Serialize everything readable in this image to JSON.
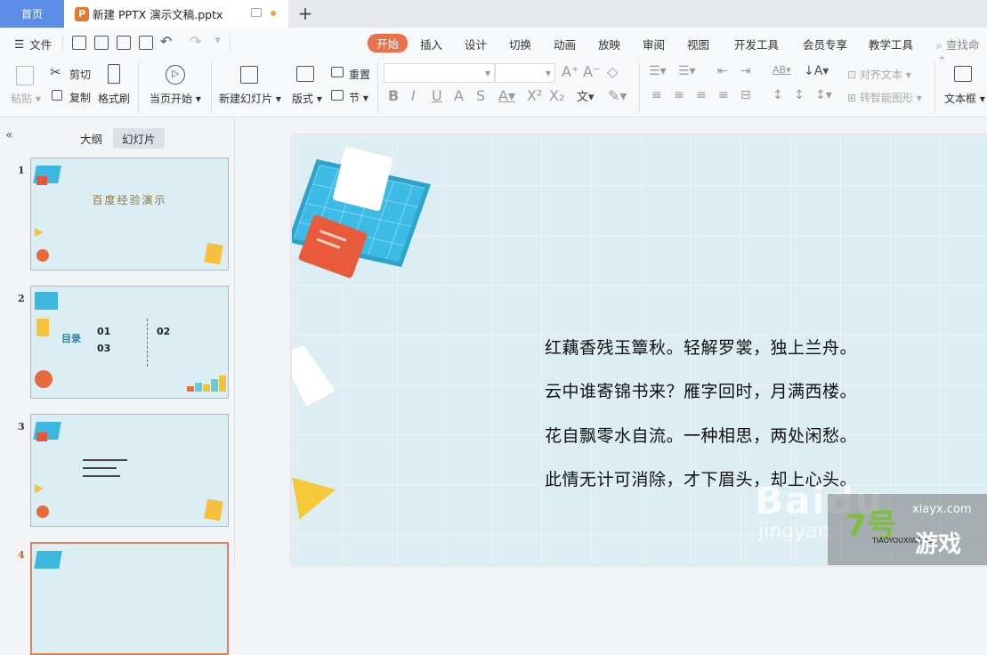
{
  "tabs": {
    "home": "首页",
    "document": "新建 PPTX 演示文稿.pptx",
    "add": "+"
  },
  "menu": {
    "file": "文件",
    "ribbon_tabs": [
      "开始",
      "插入",
      "设计",
      "切换",
      "动画",
      "放映",
      "审阅",
      "视图",
      "开发工具",
      "会员专享",
      "教学工具"
    ],
    "active_tab": "开始",
    "search": "查找命令"
  },
  "ribbon": {
    "paste": "粘贴",
    "cut": "剪切",
    "copy": "复制",
    "format_painter": "格式刷",
    "play_from_current": "当页开始",
    "new_slide": "新建幻灯片",
    "layout": "版式",
    "reset": "重置",
    "section": "节",
    "font_name": "",
    "font_size": "",
    "align_text": "对齐文本",
    "smart_art": "转智能图形",
    "textbox": "文本框"
  },
  "left_panel": {
    "outline_tab": "大纲",
    "slides_tab": "幻灯片",
    "active_view": "幻灯片",
    "slides": [
      {
        "number": "1",
        "title": "百度经验演示"
      },
      {
        "number": "2",
        "title": "目录",
        "items": [
          "01",
          "02",
          "03"
        ]
      },
      {
        "number": "3",
        "title": ""
      },
      {
        "number": "4",
        "title": "",
        "selected": true
      }
    ]
  },
  "slide": {
    "lines": [
      "红藕香残玉簟秋。轻解罗裳，独上兰舟。",
      "云中谁寄锦书来？雁字回时，月满西楼。",
      "花自飘零水自流。一种相思，两处闲愁。",
      "此情无计可消除，才下眉头，却上心头。"
    ]
  },
  "watermarks": {
    "baidu": "Baidu",
    "jingyan": "jingyan",
    "site_logo": "7号",
    "site_url": "xiayx.com",
    "site_pinyin": "TIAOYOUXIWANG",
    "site_name": "游戏"
  },
  "colors": {
    "home_tab": "#5b8de8",
    "active_ribbon": "#e8704a",
    "slide_bg": "#dcedf3",
    "selected_thumb": "#e0805a"
  }
}
